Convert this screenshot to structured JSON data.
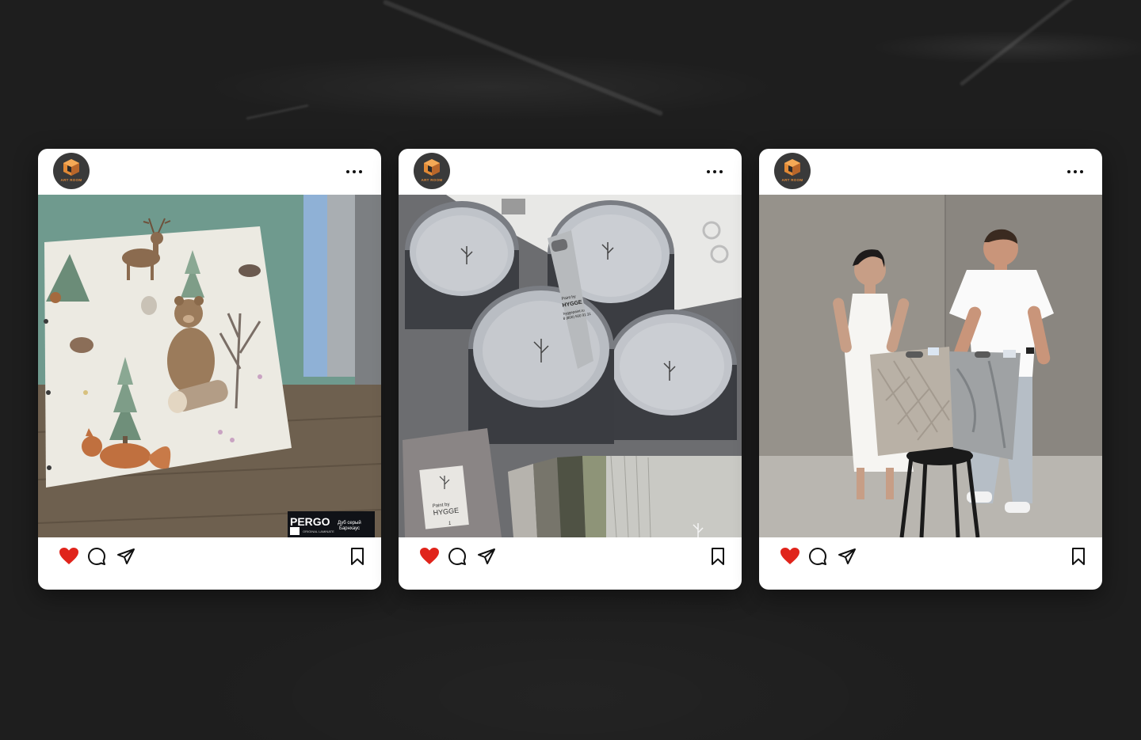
{
  "brand": {
    "name": "ART ROOM",
    "accent": "#e28a36"
  },
  "colors": {
    "like": "#e0241b",
    "icon": "#111111"
  },
  "posts": [
    {
      "photo_text": {
        "brand": "PERGO",
        "sub": "ORIGINAL LAMINATE",
        "product_line1": "Дуб серый",
        "product_line2": "Барнхаус"
      }
    },
    {
      "photo_text": {
        "can_label_1": "Paint by",
        "can_label_2": "HYGGE",
        "tag_line1": "Paint by",
        "tag_line2": "HYGGE",
        "tag_line3": "hyggepaint.ru",
        "tag_line4": "8 (800) 500 91 31",
        "sample_num": "1"
      }
    },
    {
      "photo_text": {}
    }
  ],
  "icons": [
    "more-icon",
    "heart-icon",
    "comment-icon",
    "share-icon",
    "bookmark-icon"
  ]
}
